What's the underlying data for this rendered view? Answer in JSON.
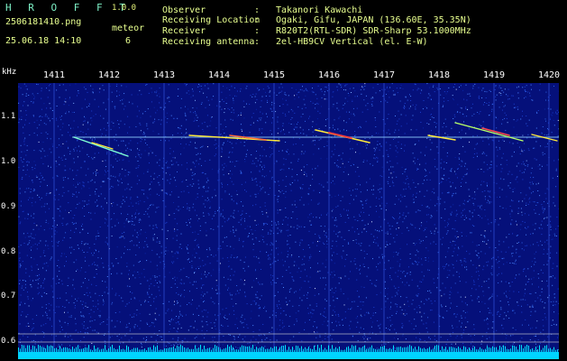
{
  "header": {
    "brand": "H R O F F T",
    "version": "1.0.0",
    "filename": "2506181410.png",
    "datetime": "25.06.18 14:10",
    "meteor_label": "meteor",
    "meteor_count": "6"
  },
  "info": [
    {
      "label": "Observer",
      "value": "Takanori Kawachi"
    },
    {
      "label": "Receiving Location",
      "value": "Ogaki, Gifu, JAPAN (136.60E, 35.35N)"
    },
    {
      "label": "Receiver",
      "value": "R820T2(RTL-SDR) SDR-Sharp 53.1000MHz"
    },
    {
      "label": "Receiving antenna",
      "value": "2el-HB9CV Vertical (el. E-W)"
    }
  ],
  "axis": {
    "y_unit": "kHz",
    "x_ticks": [
      "1411",
      "1412",
      "1413",
      "1414",
      "1415",
      "1416",
      "1417",
      "1418",
      "1419",
      "1420"
    ],
    "y_ticks": [
      "1.1",
      "1.0",
      "0.9",
      "0.8",
      "0.7",
      "0.6"
    ]
  },
  "colors": {
    "background": "#000000",
    "noise_dark": "#05107a",
    "noise_bright": "#2f63e6",
    "baseline": "#00e5ff",
    "echo": "#ffeb3b"
  }
}
